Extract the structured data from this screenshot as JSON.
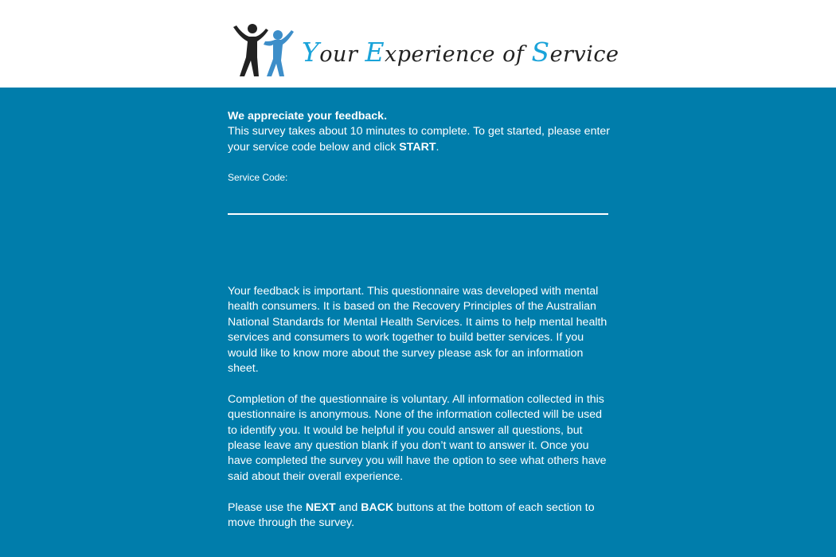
{
  "header": {
    "logo_text_parts": [
      {
        "text": "Y",
        "accent": true
      },
      {
        "text": "our ",
        "accent": false
      },
      {
        "text": "E",
        "accent": true
      },
      {
        "text": "xperience of ",
        "accent": false
      },
      {
        "text": "S",
        "accent": true
      },
      {
        "text": "ervice",
        "accent": false
      }
    ],
    "logo_figures_icon": "two-people-cheering-icon"
  },
  "intro": {
    "title": "We appreciate your feedback.",
    "line_pre": "This survey takes about 10 minutes to complete. To get started, please enter your service code below and click ",
    "line_bold": "START",
    "line_post": "."
  },
  "service_code": {
    "label": "Service Code:",
    "value": "",
    "placeholder": ""
  },
  "info": {
    "paragraph1": "Your feedback is important. This questionnaire was developed with mental health consumers. It is based on the Recovery Principles of the Australian National Standards for Mental Health Services. It aims to help mental health services and consumers to work together to build better services. If you would like to know more about the survey please ask for an information sheet.",
    "paragraph2": "Completion of the questionnaire is voluntary. All information collected in this questionnaire is anonymous. None of the information collected will be used to identify you. It would be helpful if you could answer all questions, but please leave any question blank if you don’t want to answer it. Once you have completed the survey you will have the option to see what others have said about their overall experience.",
    "paragraph3_pre": "Please use the ",
    "paragraph3_next": "NEXT",
    "paragraph3_and": " and ",
    "paragraph3_back": "BACK",
    "paragraph3_post": " buttons at the bottom of each section to move through the survey."
  },
  "colors": {
    "background": "#007dab",
    "header_bg": "#ffffff",
    "logo_accent": "#1aa3d9",
    "logo_dark": "#222222",
    "text": "#ffffff"
  }
}
